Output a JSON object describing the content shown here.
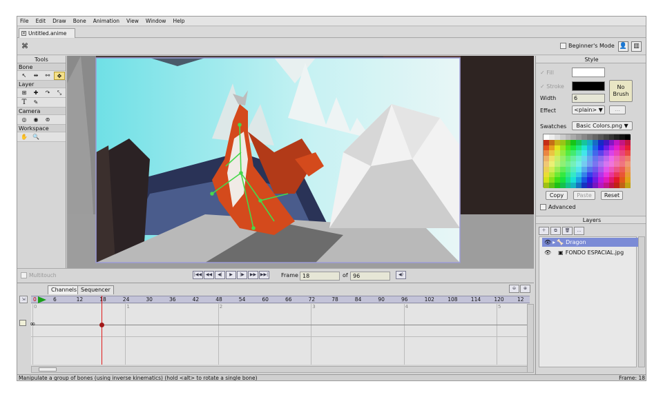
{
  "menu": [
    "File",
    "Edit",
    "Draw",
    "Bone",
    "Animation",
    "View",
    "Window",
    "Help"
  ],
  "doc_tab": "Untitled.anime",
  "beginners_mode": "Beginner's Mode",
  "tools": {
    "title": "Tools",
    "sections": {
      "bone": "Bone",
      "layer": "Layer",
      "camera": "Camera",
      "workspace": "Workspace"
    }
  },
  "playback": {
    "multitouch": "Multitouch",
    "frame_label": "Frame",
    "frame_value": "18",
    "of_label": "of",
    "total": "96"
  },
  "timeline": {
    "tab_channels": "Channels",
    "tab_sequencer": "Sequencer",
    "current": "0",
    "ticks": [
      "6",
      "12",
      "18",
      "24",
      "30",
      "36",
      "42",
      "48",
      "54",
      "60",
      "66",
      "72",
      "78",
      "84",
      "90",
      "96",
      "102",
      "108",
      "114",
      "120",
      "12"
    ],
    "seconds": [
      "0",
      "1",
      "2",
      "3",
      "4",
      "5"
    ]
  },
  "style": {
    "title": "Style",
    "fill": "Fill",
    "stroke": "Stroke",
    "width_label": "Width",
    "width_value": "6",
    "effect_label": "Effect",
    "effect_value": "<plain>",
    "no_brush": "No Brush",
    "swatches_label": "Swatches",
    "swatches_value": "Basic Colors.png",
    "copy": "Copy",
    "paste": "Paste",
    "reset": "Reset",
    "advanced": "Advanced",
    "fill_color": "#ffffff",
    "stroke_color": "#000000"
  },
  "layers": {
    "title": "Layers",
    "items": [
      {
        "name": "Dragon",
        "selected": true
      },
      {
        "name": "FONDO ESPACIAL.jpg",
        "selected": false
      }
    ]
  },
  "status": {
    "message": "Manipulate a group of bones (using inverse kinematics) (hold <alt> to rotate a single bone)",
    "frame": "Frame: 18"
  }
}
